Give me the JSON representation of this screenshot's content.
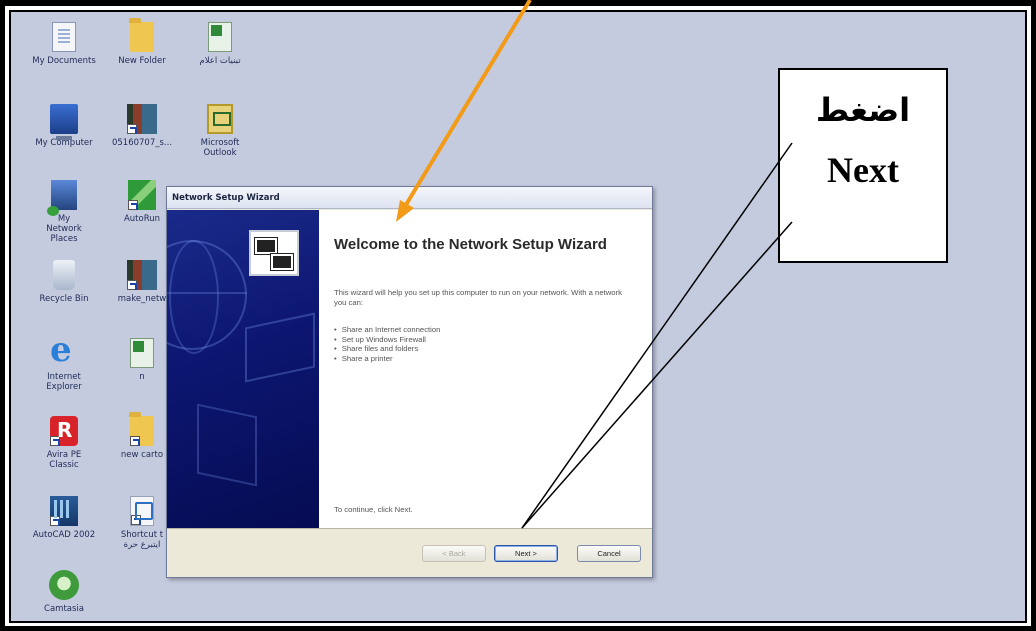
{
  "desktop": {
    "icons": [
      {
        "label": "My Documents",
        "icon": "my-documents-icon"
      },
      {
        "label": "New Folder",
        "icon": "folder-icon"
      },
      {
        "label": "تبنيات اعلام",
        "icon": "excel-file-icon"
      },
      {
        "label": "My Computer",
        "icon": "my-computer-icon"
      },
      {
        "label": "05160707_s...",
        "icon": "video-file-icon"
      },
      {
        "label": "Microsoft Outlook",
        "icon": "outlook-icon"
      },
      {
        "label": "My Network Places",
        "icon": "network-places-icon"
      },
      {
        "label": "AutoRun",
        "icon": "autorun-icon"
      },
      {
        "label": "Recycle Bin",
        "icon": "recycle-bin-icon"
      },
      {
        "label": "make_netw",
        "icon": "video-file-icon"
      },
      {
        "label": "Internet Explorer",
        "icon": "internet-explorer-icon"
      },
      {
        "label": "n",
        "icon": "excel-file-icon"
      },
      {
        "label": "Avira PE Classic",
        "icon": "avira-icon"
      },
      {
        "label": "new carto",
        "icon": "folder-icon"
      },
      {
        "label": "AutoCAD 2002",
        "icon": "autocad-icon"
      },
      {
        "label": "Shortcut t",
        "sublabel": "ايتبرع حرة",
        "icon": "shortcut-icon"
      },
      {
        "label": "Camtasia",
        "icon": "camtasia-icon"
      }
    ]
  },
  "wizard": {
    "title": "Network Setup Wizard",
    "heading": "Welcome to the Network Setup Wizard",
    "intro": "This wizard will help you set up this computer to run on your network. With a network you can:",
    "bullets": [
      "Share an Internet connection",
      "Set up Windows Firewall",
      "Share files and folders",
      "Share a printer"
    ],
    "continue_text": "To continue, click Next.",
    "buttons": {
      "back": "< Back",
      "next": "Next >",
      "cancel": "Cancel"
    }
  },
  "callout": {
    "arabic": "اضغط",
    "english": "Next"
  },
  "colors": {
    "desktop_bg": "#c5cbdf",
    "arrow": "#f39a17",
    "wizard_sidebar": "#0c1670",
    "frame": "#000000"
  }
}
